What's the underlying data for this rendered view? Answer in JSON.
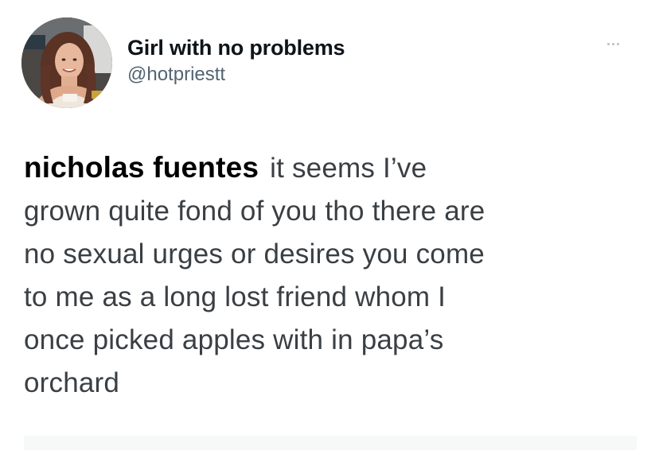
{
  "tweet": {
    "author": {
      "display_name": "Girl with no problems",
      "handle": "@hotpriestt",
      "avatar_icon": "profile-photo"
    },
    "more_icon": "more-options-icon",
    "mention": "nicholas fuentes",
    "text_lines": [
      "it seems I’ve",
      "grown quite fond of you tho there are",
      "no sexual urges or desires you come",
      "to me as a long lost friend whom I",
      "once picked apples with in papa’s",
      "orchard"
    ]
  }
}
